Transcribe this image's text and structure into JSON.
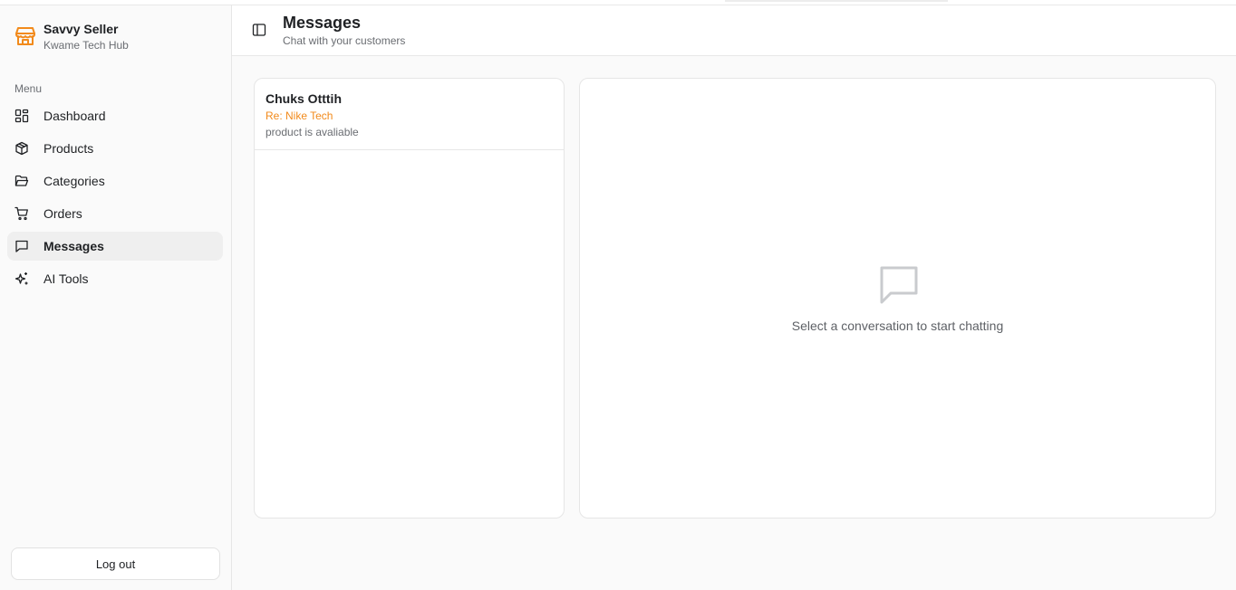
{
  "brand": {
    "name": "Savvy Seller",
    "subtitle": "Kwame Tech Hub",
    "accent_color": "#f28a1b",
    "icon": "storefront-icon"
  },
  "sidebar": {
    "menu_label": "Menu",
    "items": [
      {
        "label": "Dashboard",
        "icon": "dashboard-grid-icon",
        "active": false
      },
      {
        "label": "Products",
        "icon": "package-box-icon",
        "active": false
      },
      {
        "label": "Categories",
        "icon": "folder-open-icon",
        "active": false
      },
      {
        "label": "Orders",
        "icon": "shopping-cart-icon",
        "active": false
      },
      {
        "label": "Messages",
        "icon": "message-square-icon",
        "active": true
      },
      {
        "label": "AI Tools",
        "icon": "sparkles-icon",
        "active": false
      }
    ],
    "logout_label": "Log out"
  },
  "header": {
    "title": "Messages",
    "subtitle": "Chat with your customers",
    "toggle_icon": "sidebar-toggle-icon"
  },
  "conversations": [
    {
      "name": "Chuks Otttih",
      "subject": "Re: Nike Tech",
      "preview": "product is avaliable"
    }
  ],
  "chat": {
    "empty_icon": "message-square-icon",
    "empty_text": "Select a conversation to start chatting"
  }
}
